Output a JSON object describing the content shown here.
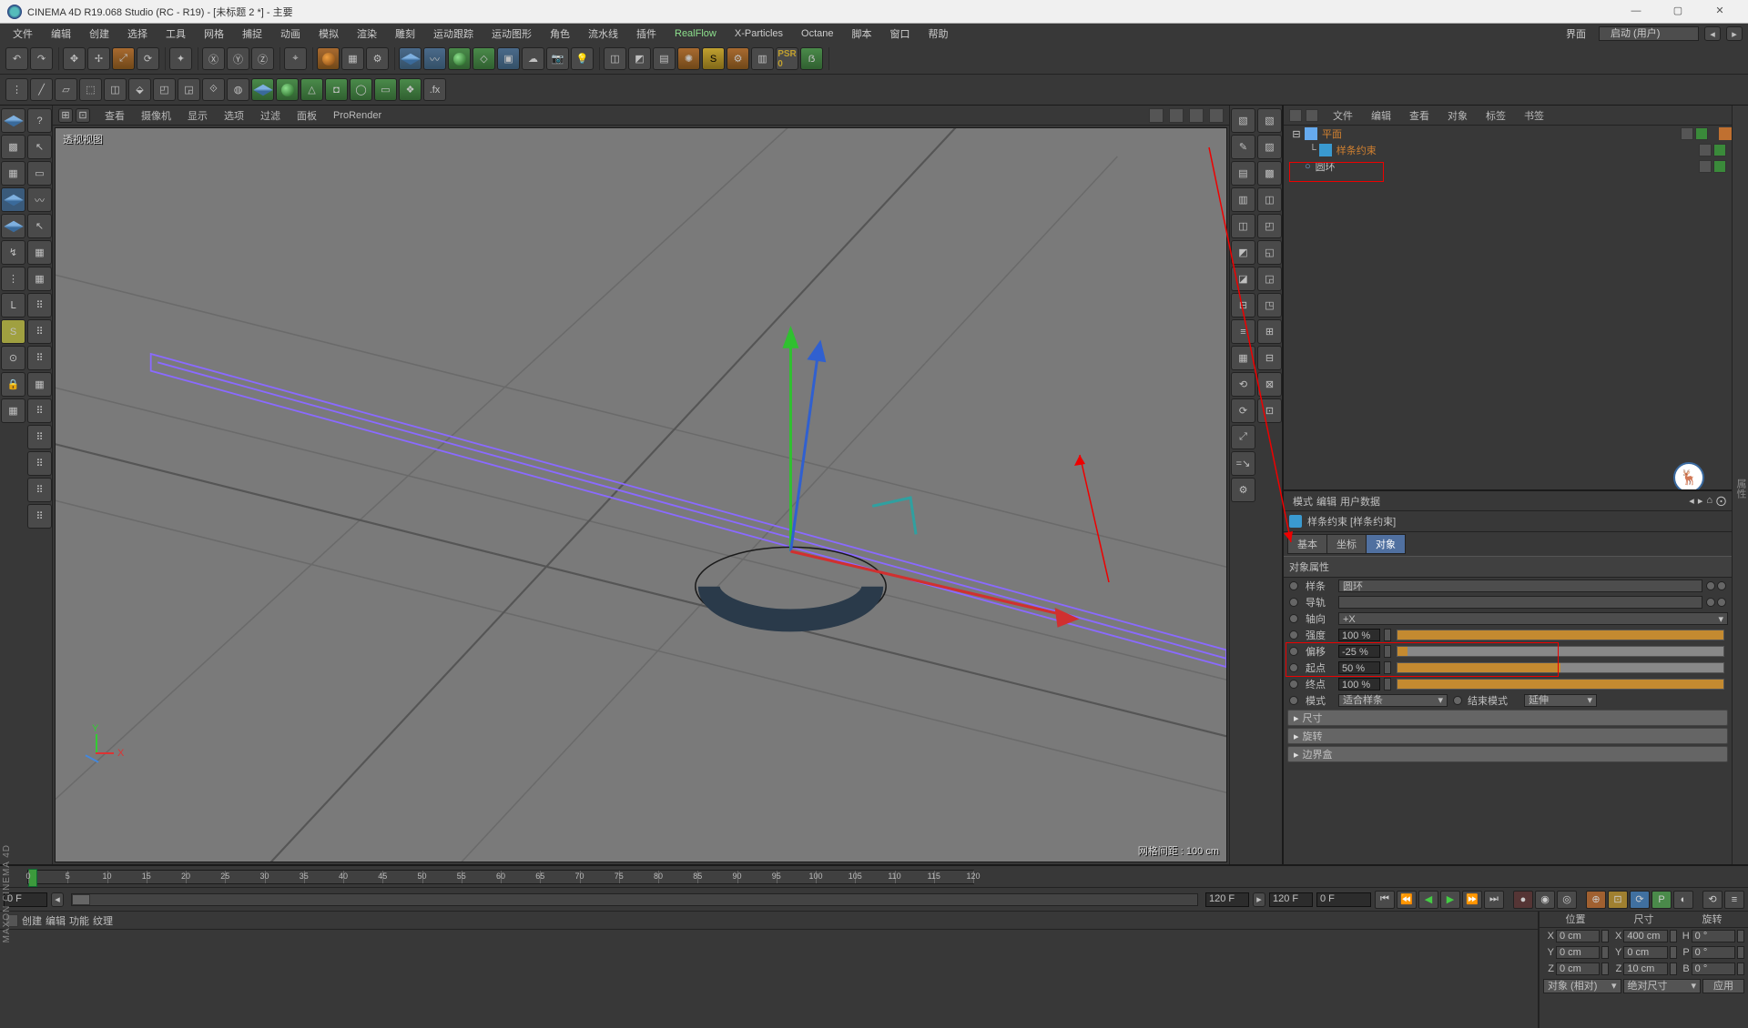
{
  "title": "CINEMA 4D R19.068 Studio (RC - R19) - [未标题 2 *] - 主要",
  "menubar": [
    "文件",
    "编辑",
    "创建",
    "选择",
    "工具",
    "网格",
    "捕捉",
    "动画",
    "模拟",
    "渲染",
    "雕刻",
    "运动跟踪",
    "运动图形",
    "角色",
    "流水线",
    "插件",
    "RealFlow",
    "X-Particles",
    "Octane",
    "脚本",
    "窗口",
    "帮助"
  ],
  "layout_label": "界面",
  "layout_value": "启动 (用户)",
  "viewport_menu": [
    "查看",
    "摄像机",
    "显示",
    "选项",
    "过滤",
    "面板",
    "ProRender"
  ],
  "viewport_label": "透视视图",
  "viewport_status": "网格间距 : 100 cm",
  "obj_tabs": [
    "文件",
    "编辑",
    "查看",
    "对象",
    "标签",
    "书签"
  ],
  "objects": [
    {
      "name": "平面",
      "icon": "plane",
      "color": "#66aaee",
      "indent": 0,
      "collapse": "⊟",
      "tag": "orange"
    },
    {
      "name": "样条约束",
      "icon": "spline-wrap",
      "color": "#3a9ad0",
      "indent": 1
    },
    {
      "name": "圆环",
      "icon": "circle",
      "color": "#66aaee",
      "indent": 0,
      "marker": "○"
    }
  ],
  "attr_tabs": [
    "模式",
    "编辑",
    "用户数据"
  ],
  "attr_title": "样条约束 [样条约束]",
  "attr_subtabs": [
    "基本",
    "坐标",
    "对象"
  ],
  "attr_group": "对象属性",
  "attrs": {
    "spline_label": "样条",
    "spline_value": "圆环",
    "rail_label": "导轨",
    "axis_label": "轴向",
    "axis_value": "+X",
    "strength_label": "强度",
    "strength_value": "100 %",
    "offset_label": "偏移",
    "offset_value": "-25 %",
    "from_label": "起点",
    "from_value": "50 %",
    "to_label": "终点",
    "to_value": "100 %",
    "mode_label": "模式",
    "mode_value": "适合样条",
    "endmode_label": "结束模式",
    "endmode_value": "延伸"
  },
  "attr_collapse": [
    "尺寸",
    "旋转",
    "边界盒"
  ],
  "timeline": {
    "start": "0 F",
    "current": "0 F",
    "preview_end": "120 F",
    "end": "120 F",
    "ticks": [
      0,
      5,
      10,
      15,
      20,
      25,
      30,
      35,
      40,
      45,
      50,
      55,
      60,
      65,
      70,
      75,
      80,
      85,
      90,
      95,
      100,
      105,
      110,
      115,
      120
    ]
  },
  "console_menu": [
    "创建",
    "编辑",
    "功能",
    "纹理"
  ],
  "coord": {
    "headers": [
      "位置",
      "尺寸",
      "旋转"
    ],
    "rows": [
      {
        "ax": "X",
        "p": "0 cm",
        "s": "400 cm",
        "r": "0 °"
      },
      {
        "ax": "Y",
        "p": "0 cm",
        "s": "0 cm",
        "r": "0 °"
      },
      {
        "ax": "Z",
        "p": "0 cm",
        "s": "10 cm",
        "r": "0 °"
      }
    ],
    "pos_mode": "对象 (相对)",
    "size_mode": "绝对尺寸",
    "apply": "应用"
  },
  "axes": {
    "x": "X",
    "y": "Y"
  },
  "logo": "MAXON CINEMA 4D"
}
